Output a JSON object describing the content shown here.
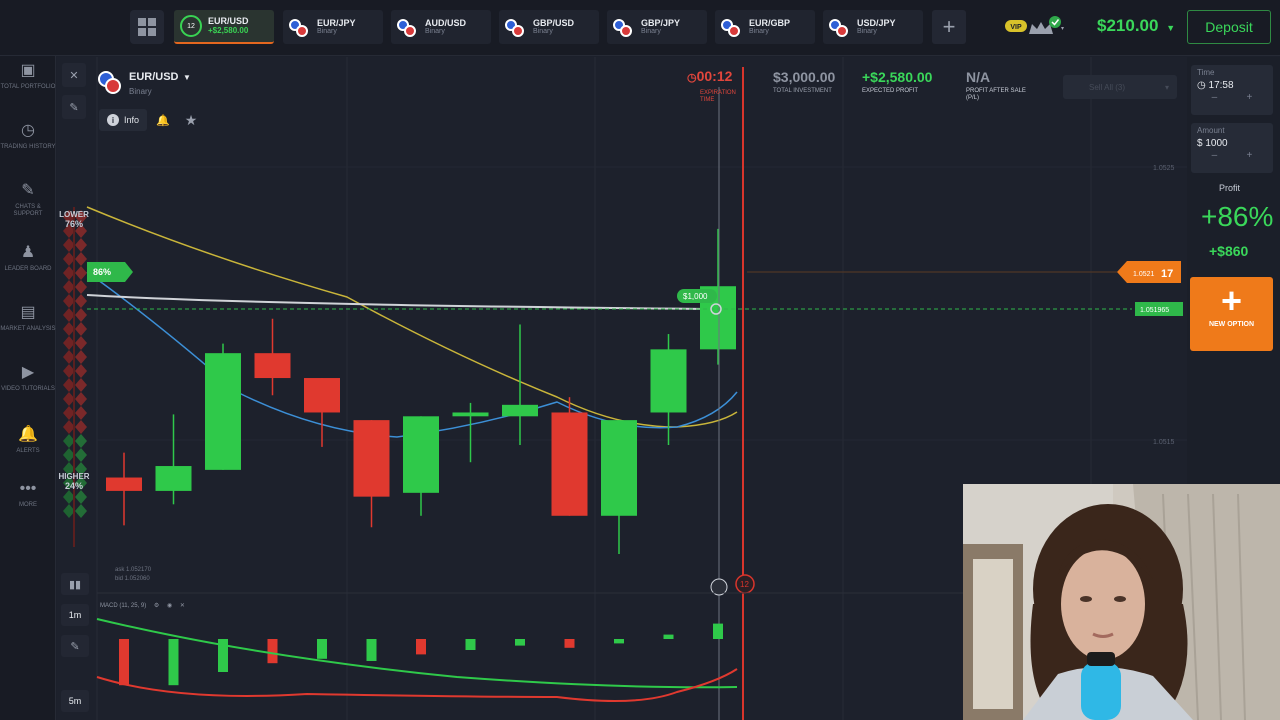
{
  "topbar": {
    "active_tab": {
      "symbol": "EUR/USD",
      "profit": "+$2,580.00",
      "timer": "12"
    },
    "tabs": [
      {
        "symbol": "EUR/JPY",
        "type": "Binary"
      },
      {
        "symbol": "AUD/USD",
        "type": "Binary"
      },
      {
        "symbol": "GBP/USD",
        "type": "Binary"
      },
      {
        "symbol": "GBP/JPY",
        "type": "Binary"
      },
      {
        "symbol": "EUR/GBP",
        "type": "Binary"
      },
      {
        "symbol": "USD/JPY",
        "type": "Binary"
      }
    ],
    "add_tab": "+",
    "vip_badge": "VIP",
    "balance": "$210.00",
    "deposit_label": "Deposit"
  },
  "sidebar": {
    "items": [
      {
        "label": "TOTAL PORTFOLIO",
        "icon": "portfolio-icon",
        "glyph": "▣"
      },
      {
        "label": "TRADING HISTORY",
        "icon": "history-icon",
        "glyph": "◷"
      },
      {
        "label": "CHATS & SUPPORT",
        "icon": "chat-icon",
        "glyph": "✎"
      },
      {
        "label": "LEADER BOARD",
        "icon": "leaderboard-icon",
        "glyph": "♟"
      },
      {
        "label": "MARKET ANALYSIS",
        "icon": "market-icon",
        "glyph": "▤"
      },
      {
        "label": "VIDEO TUTORIALS",
        "icon": "video-icon",
        "glyph": "▶"
      },
      {
        "label": "ALERTS",
        "icon": "bell-icon",
        "glyph": "🔔"
      },
      {
        "label": "MORE",
        "icon": "more-icon",
        "glyph": "•••"
      }
    ]
  },
  "chart": {
    "asset": "EUR/USD",
    "asset_type": "Binary",
    "info_label": "Info",
    "expiration_time": "00:12",
    "expiration_label": "EXPIRATION TIME",
    "total_investment": "$3,000.00",
    "total_investment_label": "TOTAL INVESTMENT",
    "expected_profit": "+$2,580.00",
    "expected_profit_label": "EXPECTED PROFIT",
    "profit_after_sale": "N/A",
    "profit_after_sale_label": "PROFIT AFTER SALE (P/L)",
    "sell_all": "Sell All (3)",
    "lower_label": "LOWER",
    "lower_pct": "76%",
    "higher_label": "HIGHER",
    "higher_pct": "24%",
    "position_tag": "86%",
    "deal_tag": "$1,000",
    "price_high": "1.0525",
    "price_low": "1.0515",
    "current_price_big": "1.05217",
    "current_price_prefix": "1.0521",
    "current_price_suffix": "17",
    "strike_price": "1.051965",
    "ask": "ask 1.052170",
    "bid": "bid 1.052060",
    "timer_bubble": "12",
    "macd_label": "MACD (11, 25, 9)",
    "timeframes": [
      "1m",
      "5m"
    ]
  },
  "right_panel": {
    "time_label": "Time",
    "time_value": "17:58",
    "amount_label": "Amount",
    "amount_value": "$ 1000",
    "profit_label": "Profit",
    "profit_pct": "+86%",
    "profit_amount": "+$860",
    "new_option_label": "NEW OPTION"
  },
  "chart_data": {
    "type": "candlestick",
    "series_candles": [
      {
        "o": 1.05182,
        "c": 1.05175,
        "h": 1.05195,
        "l": 1.05157
      },
      {
        "o": 1.05175,
        "c": 1.05188,
        "h": 1.05215,
        "l": 1.05168
      },
      {
        "o": 1.05186,
        "c": 1.05247,
        "h": 1.05252,
        "l": 1.05186
      },
      {
        "o": 1.05247,
        "c": 1.05234,
        "h": 1.05265,
        "l": 1.05225
      },
      {
        "o": 1.05234,
        "c": 1.05216,
        "h": 1.05234,
        "l": 1.05198
      },
      {
        "o": 1.05212,
        "c": 1.05172,
        "h": 1.05212,
        "l": 1.05156
      },
      {
        "o": 1.05174,
        "c": 1.05214,
        "h": 1.05214,
        "l": 1.05162
      },
      {
        "o": 1.05214,
        "c": 1.05216,
        "h": 1.05221,
        "l": 1.0519
      },
      {
        "o": 1.05214,
        "c": 1.0522,
        "h": 1.05262,
        "l": 1.05199
      },
      {
        "o": 1.05216,
        "c": 1.05162,
        "h": 1.05224,
        "l": 1.05162
      },
      {
        "o": 1.05162,
        "c": 1.05212,
        "h": 1.05212,
        "l": 1.05142
      },
      {
        "o": 1.05216,
        "c": 1.05249,
        "h": 1.05257,
        "l": 1.05199
      },
      {
        "o": 1.05249,
        "c": 1.05282,
        "h": 1.05312,
        "l": 1.05241
      }
    ],
    "price_range": [
      1.0513,
      1.0536
    ],
    "macd_histogram": [
      -0.42,
      -0.42,
      -0.3,
      -0.22,
      -0.18,
      -0.2,
      -0.14,
      -0.1,
      -0.06,
      -0.08,
      -0.04,
      0.04,
      0.14
    ]
  }
}
